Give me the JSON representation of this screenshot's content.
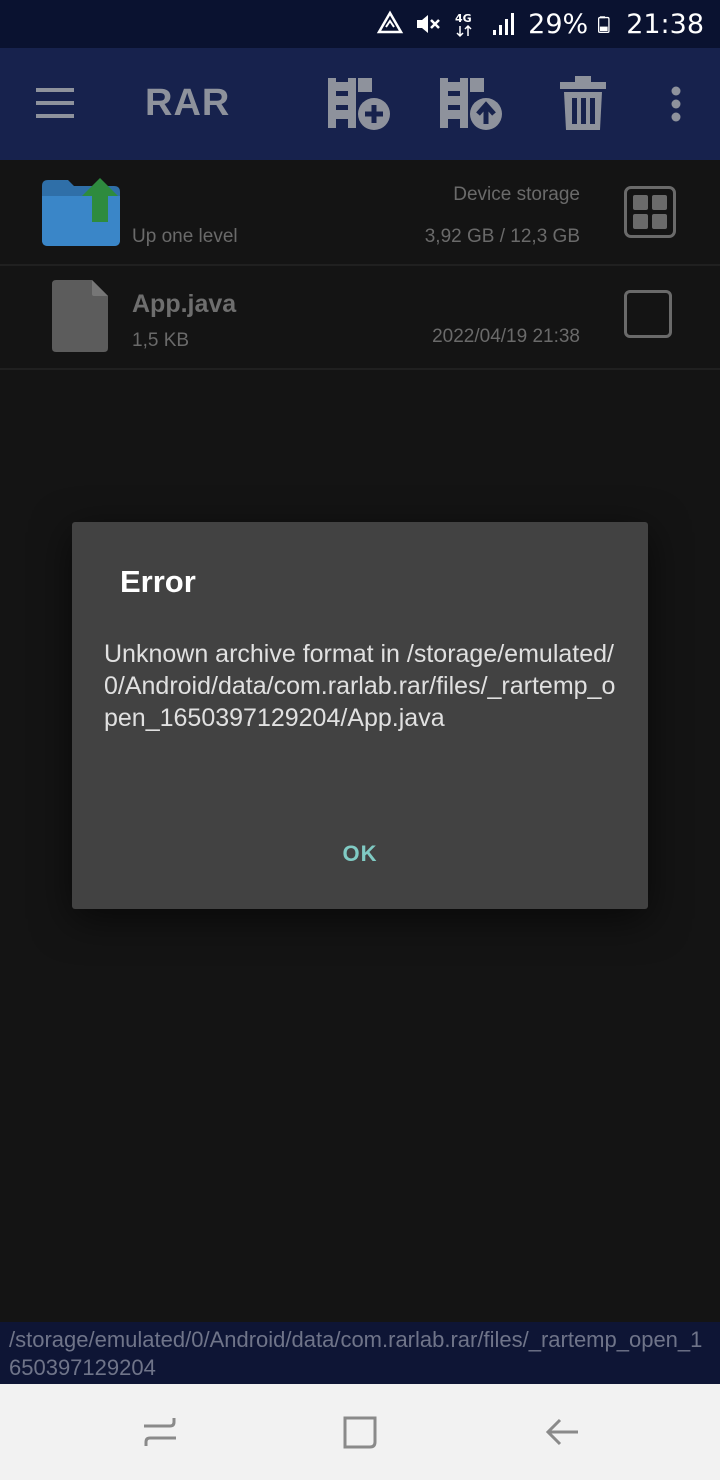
{
  "status_bar": {
    "battery_percent": "29%",
    "time": "21:38",
    "network": "4G",
    "icons": [
      "data-saver-icon",
      "mute-icon",
      "network-4g-icon",
      "signal-icon",
      "battery-icon"
    ]
  },
  "app_bar": {
    "title": "RAR",
    "icons": [
      "menu-icon",
      "add-to-archive-icon",
      "extract-icon",
      "delete-icon",
      "more-vert-icon"
    ]
  },
  "file_list": {
    "up_row": {
      "label": "Up one level",
      "storage_label": "Device storage",
      "storage_usage": "3,92 GB / 12,3 GB"
    },
    "files": [
      {
        "name": "App.java",
        "size": "1,5 KB",
        "date": "2022/04/19 21:38"
      }
    ]
  },
  "dialog": {
    "title": "Error",
    "message": "Unknown archive format in /storage/emulated/0/Android/data/com.rarlab.rar/files/_rartemp_open_1650397129204/App.java",
    "ok_label": "OK"
  },
  "path_bar": {
    "path": "/storage/emulated/0/Android/data/com.rarlab.rar/files/_rartemp_open_1650397129204"
  },
  "nav_bar": {
    "icons": [
      "recent-apps-icon",
      "home-icon",
      "back-icon"
    ]
  },
  "colors": {
    "app_bar": "#17224d",
    "status_bar": "#0a1230",
    "dialog_bg": "#424242",
    "dialog_button": "#80cbc4",
    "folder": "#3a86c8",
    "up_arrow": "#2e8b3e"
  }
}
